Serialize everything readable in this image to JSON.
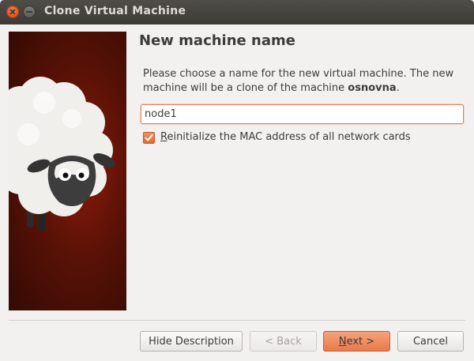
{
  "window": {
    "title": "Clone Virtual Machine"
  },
  "page": {
    "heading": "New machine name",
    "description_prefix": "Please choose a name for the new virtual machine. The new machine will be a clone of the machine ",
    "source_machine": "osnovna",
    "description_suffix": "."
  },
  "form": {
    "name_value": "node1",
    "reinit_mac": {
      "label": "Reinitialize the MAC address of all network cards",
      "checked": true
    }
  },
  "buttons": {
    "hide_description": "Hide Description",
    "back": "< Back",
    "next": "Next >",
    "cancel": "Cancel"
  },
  "colors": {
    "accent": "#e9794a",
    "titlebar": "#3c3b37",
    "side_image_bg": "#5a1206"
  },
  "icons": {
    "close": "close-icon",
    "minimize": "minimize-icon",
    "checkbox": "check-icon"
  }
}
